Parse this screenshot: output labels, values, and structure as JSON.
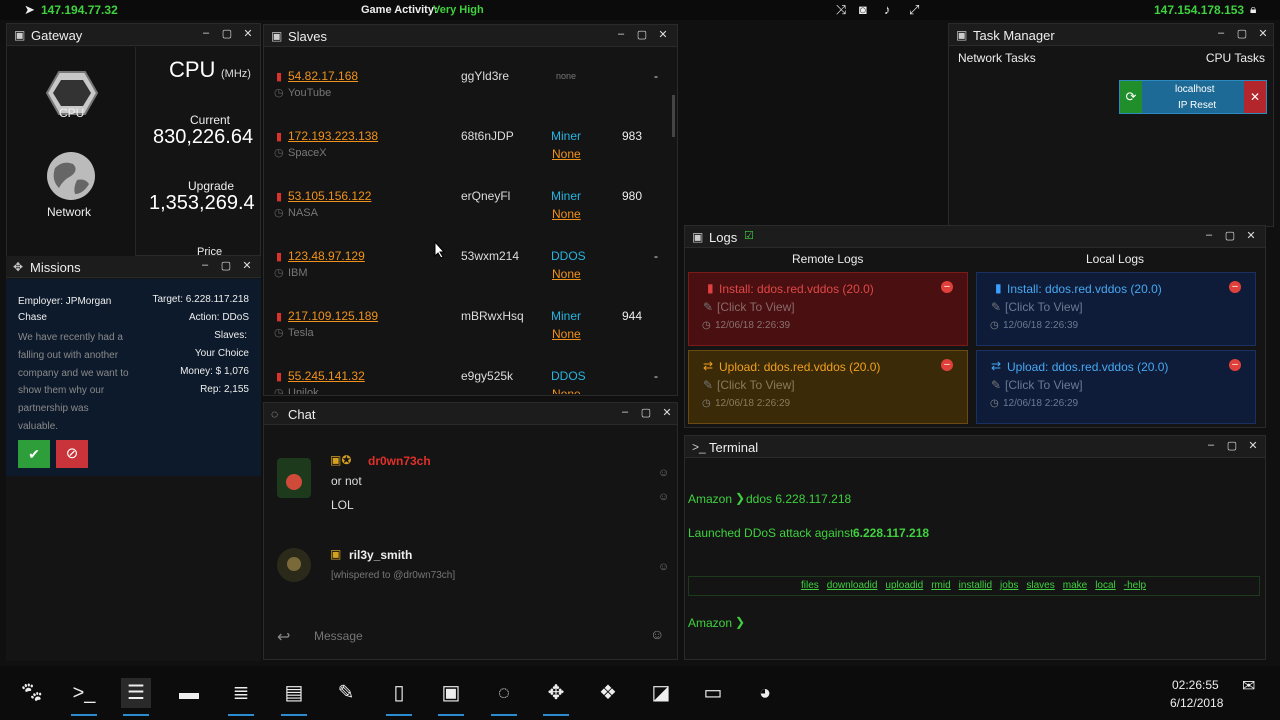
{
  "topbar": {
    "left_ip": "147.194.77.32",
    "activity_label": "Game Activity:",
    "activity_value": "Very High",
    "right_ip": "147.154.178.153"
  },
  "gateway": {
    "title": "Gateway",
    "cpu_label": "CPU",
    "network_label": "Network",
    "cpu_heading": "CPU",
    "cpu_unit": "(MHz)",
    "current_label": "Current",
    "current_value": "830,226.64",
    "upgrade_label": "Upgrade",
    "upgrade_value": "1,353,269.4",
    "price_label": "Price"
  },
  "missions": {
    "title": "Missions",
    "employer": "Employer: JPMorgan Chase",
    "description": "We have recently had a falling out with another company and we want to show them why our partnership was valuable.",
    "target": "Target: 6.228.117.218",
    "action": "Action: DDoS",
    "slaves_label": "Slaves:",
    "slaves_value": "Your Choice",
    "money": "Money: $ 1,076",
    "rep": "Rep: 2,155"
  },
  "slaves": {
    "title": "Slaves",
    "rows": [
      {
        "ip": "54.82.17.168",
        "company": "YouTube",
        "pass": "ggYld3re",
        "type": "none",
        "sub": "",
        "total": "-",
        "bar": 0
      },
      {
        "ip": "172.193.223.138",
        "company": "SpaceX",
        "pass": "68t6nJDP",
        "type": "Miner",
        "sub": "None",
        "total": "983",
        "bar": 0.04
      },
      {
        "ip": "53.105.156.122",
        "company": "NASA",
        "pass": "erQneyFl",
        "type": "Miner",
        "sub": "None",
        "total": "980",
        "bar": 0.2
      },
      {
        "ip": "123.48.97.129",
        "company": "IBM",
        "pass": "53wxm214",
        "type": "DDOS",
        "sub": "None",
        "total": "-",
        "bar": 0
      },
      {
        "ip": "217.109.125.189",
        "company": "Tesla",
        "pass": "mBRwxHsq",
        "type": "Miner",
        "sub": "None",
        "total": "944",
        "bar": 0.95
      },
      {
        "ip": "55.245.141.32",
        "company": "Unilok",
        "pass": "e9gy525k",
        "type": "DDOS",
        "sub": "None",
        "total": "-",
        "bar": 0
      }
    ]
  },
  "task_manager": {
    "title": "Task Manager",
    "network_tasks": "Network Tasks",
    "cpu_tasks": "CPU Tasks",
    "task_host": "localhost",
    "task_name": "IP Reset"
  },
  "logs": {
    "title": "Logs",
    "remote": "Remote Logs",
    "local": "Local Logs",
    "items": [
      {
        "text": "Install: ddos.red.vddos (20.0)",
        "view": "[Click To View]",
        "time": "12/06/18 2:26:39"
      },
      {
        "text": "Install: ddos.red.vddos (20.0)",
        "view": "[Click To View]",
        "time": "12/06/18 2:26:39"
      },
      {
        "text": "Upload: ddos.red.vddos (20.0)",
        "view": "[Click To View]",
        "time": "12/06/18 2:26:29"
      },
      {
        "text": "Upload: ddos.red.vddos (20.0)",
        "view": "[Click To View]",
        "time": "12/06/18 2:26:29"
      }
    ]
  },
  "chat": {
    "title": "Chat",
    "msg1_user": "dr0wn73ch",
    "msg1_line1": "or not",
    "msg1_line2": "LOL",
    "msg2_user": "ril3y_smith",
    "msg2_note": "[whispered to @dr0wn73ch]",
    "placeholder": "Message"
  },
  "terminal": {
    "title": "Terminal",
    "prompt": "Amazon",
    "cmd": "ddos 6.228.117.218",
    "output": "Launched DDoS attack against",
    "output_ip": "6.228.117.218",
    "help": [
      "files",
      "downloadid",
      "uploadid",
      "rmid",
      "installid",
      "jobs",
      "slaves",
      "make",
      "local",
      "-help"
    ],
    "prompt2": "Amazon"
  },
  "clock": {
    "time": "02:26:55",
    "date": "6/12/2018"
  }
}
